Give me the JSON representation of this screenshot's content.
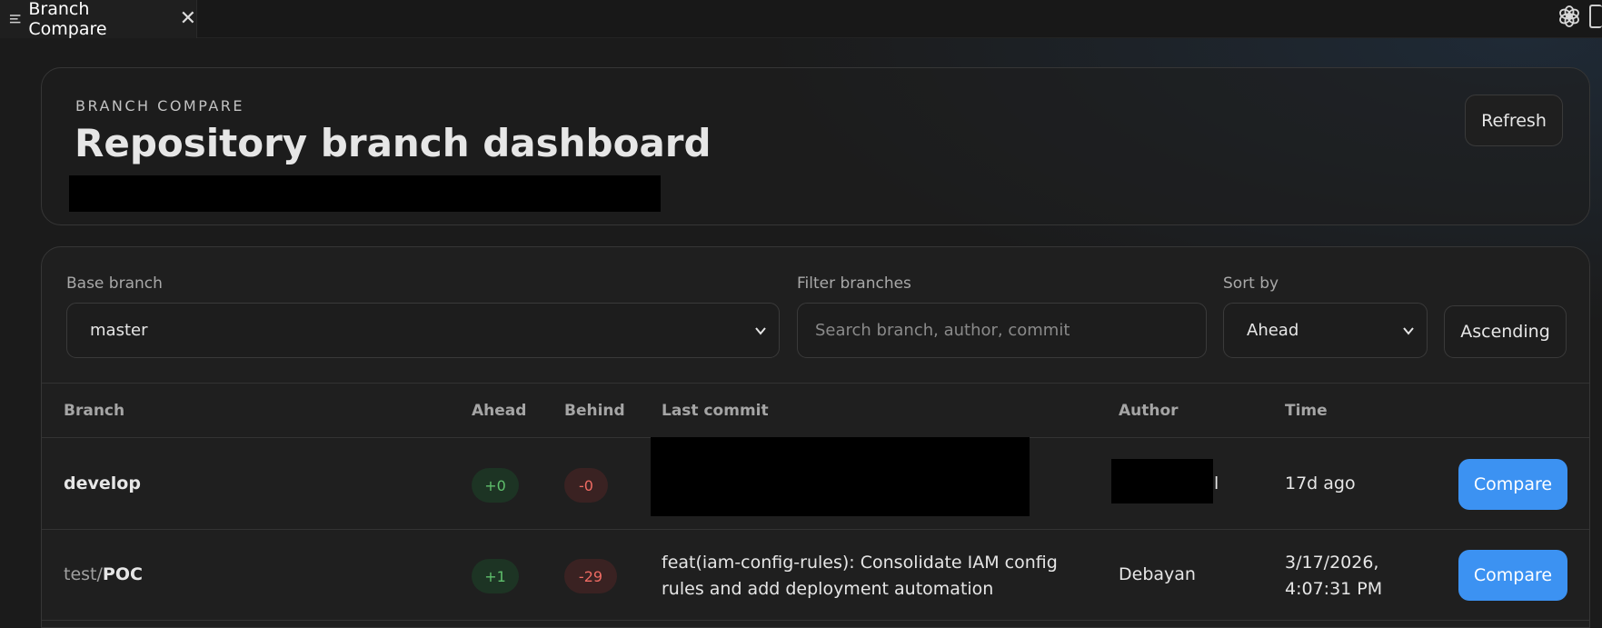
{
  "tab": {
    "title": "Branch Compare",
    "close": "✕"
  },
  "header": {
    "eyebrow": "BRANCH COMPARE",
    "title": "Repository branch dashboard",
    "refresh_label": "Refresh"
  },
  "filters": {
    "base_branch_label": "Base branch",
    "base_branch_value": "master",
    "filter_label": "Filter branches",
    "filter_placeholder": "Search branch, author, commit",
    "sort_label": "Sort by",
    "sort_value": "Ahead",
    "order_label": "Ascending"
  },
  "table": {
    "columns": [
      "Branch",
      "Ahead",
      "Behind",
      "Last commit",
      "Author",
      "Time"
    ],
    "rows": [
      {
        "branch_prefix": "",
        "branch_name": "develop",
        "ahead": "+0",
        "behind": "-0",
        "last_commit": "",
        "author": "l",
        "time": "17d ago",
        "action": "Compare"
      },
      {
        "branch_prefix": "test/",
        "branch_name": "POC",
        "ahead": "+1",
        "behind": "-29",
        "last_commit": "feat(iam-config-rules): Consolidate IAM config rules and add deployment automation",
        "author": "Debayan",
        "time": "3/17/2026, 4:07:31 PM",
        "action": "Compare"
      }
    ]
  },
  "colors": {
    "accent": "#3c92f2",
    "ahead_text": "#5fbf6c",
    "behind_text": "#ef6b63"
  }
}
